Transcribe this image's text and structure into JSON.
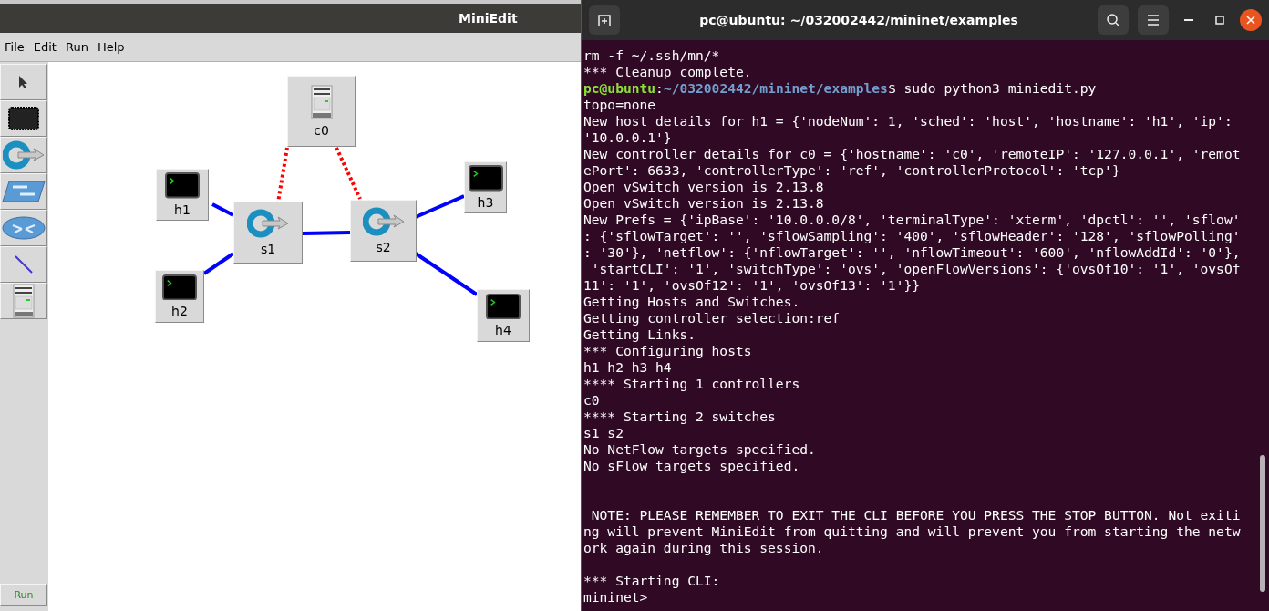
{
  "miniedit": {
    "title": "MiniEdit",
    "menu": [
      "File",
      "Edit",
      "Run",
      "Help"
    ],
    "tools": [
      {
        "kind": "select"
      },
      {
        "kind": "host"
      },
      {
        "kind": "switch"
      },
      {
        "kind": "legacy_switch"
      },
      {
        "kind": "router"
      },
      {
        "kind": "link"
      },
      {
        "kind": "controller"
      }
    ],
    "run_button": "Run",
    "nodes": [
      {
        "kind": "controller",
        "label": "c0"
      },
      {
        "kind": "host",
        "label": "h1"
      },
      {
        "kind": "switch",
        "label": "s1"
      },
      {
        "kind": "switch",
        "label": "s2"
      },
      {
        "kind": "host",
        "label": "h3"
      },
      {
        "kind": "host",
        "label": "h2"
      },
      {
        "kind": "host",
        "label": "h4"
      }
    ],
    "links": [
      {
        "kind": "control"
      },
      {
        "kind": "control"
      },
      {
        "kind": "data"
      },
      {
        "kind": "data"
      },
      {
        "kind": "data"
      },
      {
        "kind": "data"
      },
      {
        "kind": "data"
      }
    ]
  },
  "terminal": {
    "title": "pc@ubuntu: ~/032002442/mininet/examples",
    "lines": [
      {
        "kind": "output",
        "text": "rm -f ~/.ssh/mn/*"
      },
      {
        "kind": "output",
        "text": "*** Cleanup complete."
      },
      {
        "kind": "prompt",
        "user": "pc@ubuntu",
        "sep": ":",
        "path": "~/032002442/mininet/examples",
        "text": "$ sudo python3 miniedit.py"
      },
      {
        "kind": "output",
        "text": "topo=none"
      },
      {
        "kind": "output",
        "text": "New host details for h1 = {'nodeNum': 1, 'sched': 'host', 'hostname': 'h1', 'ip':"
      },
      {
        "kind": "output",
        "text": "'10.0.0.1'}"
      },
      {
        "kind": "output",
        "text": "New controller details for c0 = {'hostname': 'c0', 'remoteIP': '127.0.0.1', 'remot"
      },
      {
        "kind": "output",
        "text": "ePort': 6633, 'controllerType': 'ref', 'controllerProtocol': 'tcp'}"
      },
      {
        "kind": "output",
        "text": "Open vSwitch version is 2.13.8"
      },
      {
        "kind": "output",
        "text": "Open vSwitch version is 2.13.8"
      },
      {
        "kind": "output",
        "text": "New Prefs = {'ipBase': '10.0.0.0/8', 'terminalType': 'xterm', 'dpctl': '', 'sflow'"
      },
      {
        "kind": "output",
        "text": ": {'sflowTarget': '', 'sflowSampling': '400', 'sflowHeader': '128', 'sflowPolling'"
      },
      {
        "kind": "output",
        "text": ": '30'}, 'netflow': {'nflowTarget': '', 'nflowTimeout': '600', 'nflowAddId': '0'},"
      },
      {
        "kind": "output",
        "text": " 'startCLI': '1', 'switchType': 'ovs', 'openFlowVersions': {'ovsOf10': '1', 'ovsOf"
      },
      {
        "kind": "output",
        "text": "11': '1', 'ovsOf12': '1', 'ovsOf13': '1'}}"
      },
      {
        "kind": "output",
        "text": "Getting Hosts and Switches."
      },
      {
        "kind": "output",
        "text": "Getting controller selection:ref"
      },
      {
        "kind": "output",
        "text": "Getting Links."
      },
      {
        "kind": "output",
        "text": "*** Configuring hosts"
      },
      {
        "kind": "output",
        "text": "h1 h2 h3 h4"
      },
      {
        "kind": "output",
        "text": "**** Starting 1 controllers"
      },
      {
        "kind": "output",
        "text": "c0"
      },
      {
        "kind": "output",
        "text": "**** Starting 2 switches"
      },
      {
        "kind": "output",
        "text": "s1 s2"
      },
      {
        "kind": "output",
        "text": "No NetFlow targets specified."
      },
      {
        "kind": "output",
        "text": "No sFlow targets specified."
      },
      {
        "kind": "blank"
      },
      {
        "kind": "blank"
      },
      {
        "kind": "output",
        "text": " NOTE: PLEASE REMEMBER TO EXIT THE CLI BEFORE YOU PRESS THE STOP BUTTON. Not exiti"
      },
      {
        "kind": "output",
        "text": "ng will prevent MiniEdit from quitting and will prevent you from starting the netw"
      },
      {
        "kind": "output",
        "text": "ork again during this session."
      },
      {
        "kind": "blank"
      },
      {
        "kind": "output",
        "text": "*** Starting CLI:"
      },
      {
        "kind": "output",
        "text": "mininet>"
      }
    ]
  }
}
